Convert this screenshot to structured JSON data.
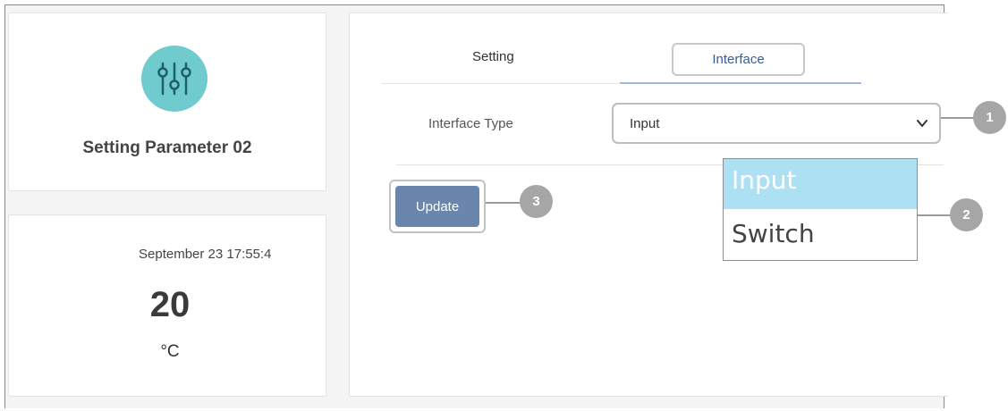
{
  "device": {
    "name": "Setting Parameter 02",
    "icon": "sliders-icon",
    "icon_color": "#6fcbce"
  },
  "reading": {
    "timestamp": "September 23 17:55:4",
    "value": "20",
    "unit": "°C"
  },
  "tabs": [
    {
      "label": "Setting"
    },
    {
      "label": "Interface"
    }
  ],
  "form": {
    "label": "Interface Type",
    "selected": "Input",
    "options": [
      "Input",
      "Switch"
    ],
    "update_label": "Update",
    "button_color": "#6b86ad",
    "highlight_color": "#aee0f4"
  },
  "callouts": [
    "1",
    "2",
    "3"
  ]
}
